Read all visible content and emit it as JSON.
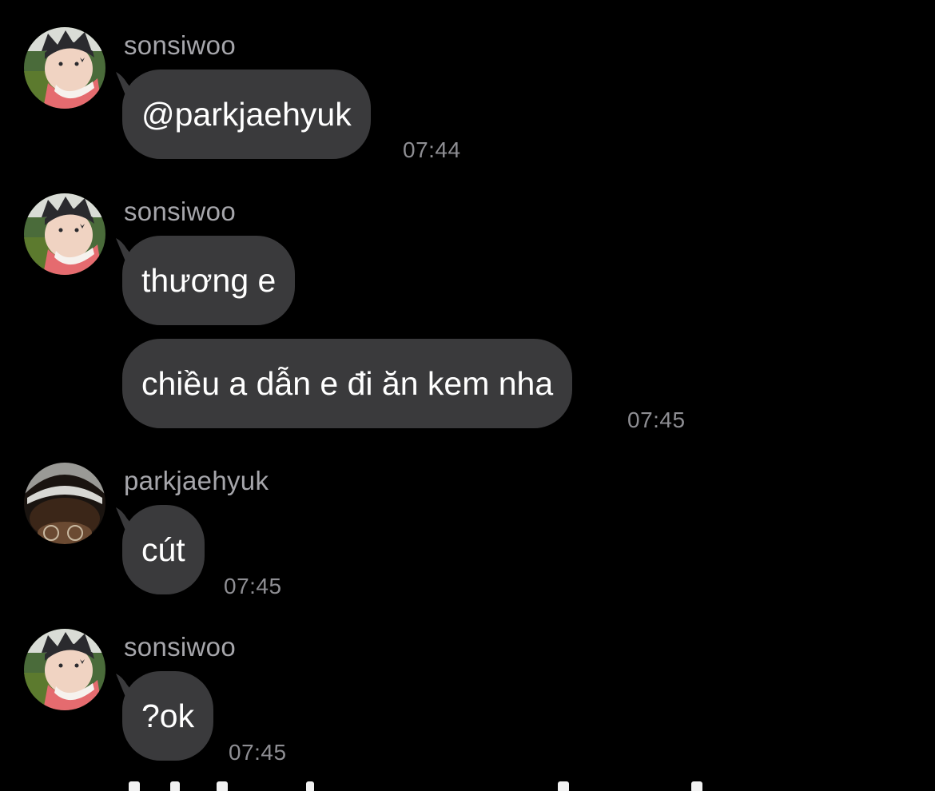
{
  "messages": [
    {
      "sender": "sonsiwoo",
      "avatar": "sonsiwoo-avatar",
      "bubbles": [
        "@parkjaehyuk"
      ],
      "time": "07:44"
    },
    {
      "sender": "sonsiwoo",
      "avatar": "sonsiwoo-avatar",
      "bubbles": [
        "thương e",
        "chiều a dẫn e đi ăn kem nha"
      ],
      "time": "07:45"
    },
    {
      "sender": "parkjaehyuk",
      "avatar": "parkjaehyuk-avatar",
      "bubbles": [
        "cút"
      ],
      "time": "07:45"
    },
    {
      "sender": "sonsiwoo",
      "avatar": "sonsiwoo-avatar",
      "bubbles": [
        "?ok"
      ],
      "time": "07:45"
    }
  ],
  "colors": {
    "background": "#000000",
    "bubble": "#3a3a3c",
    "sender_text": "#a6a6ab",
    "timestamp_text": "#8e8e93",
    "message_text": "#ffffff"
  }
}
